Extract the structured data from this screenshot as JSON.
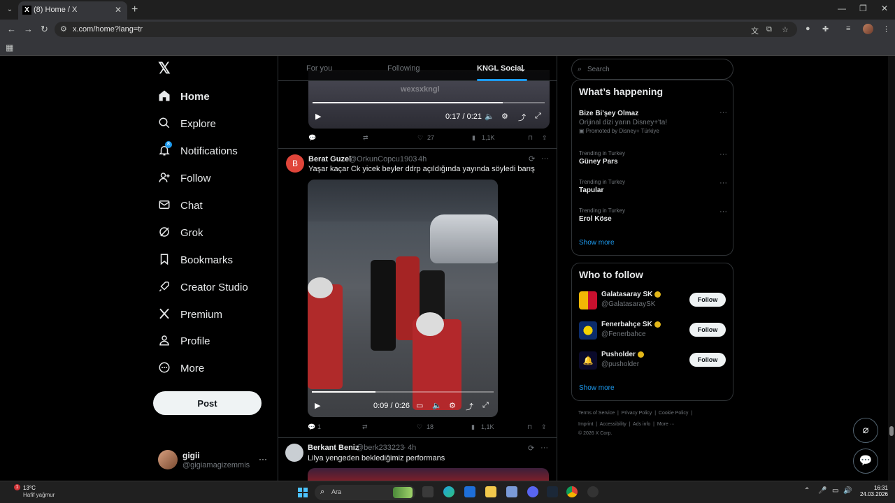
{
  "browser": {
    "tab_title": "(8) Home / X",
    "tab_favicon": "X",
    "url": "x.com/home?lang=tr"
  },
  "nav": {
    "items": [
      {
        "label": "Home",
        "icon": "home-icon"
      },
      {
        "label": "Explore",
        "icon": "search-icon"
      },
      {
        "label": "Notifications",
        "icon": "bell-icon",
        "badge": "8"
      },
      {
        "label": "Follow",
        "icon": "add-user-icon"
      },
      {
        "label": "Chat",
        "icon": "mail-icon"
      },
      {
        "label": "Grok",
        "icon": "grok-icon"
      },
      {
        "label": "Bookmarks",
        "icon": "bookmark-icon"
      },
      {
        "label": "Creator Studio",
        "icon": "rocket-icon"
      },
      {
        "label": "Premium",
        "icon": "x-icon"
      },
      {
        "label": "Profile",
        "icon": "person-icon"
      },
      {
        "label": "More",
        "icon": "more-circle-icon"
      }
    ],
    "post_label": "Post",
    "account": {
      "name": "gigii",
      "handle": "@gigiamagizemmis"
    }
  },
  "timeline": {
    "tabs": [
      "For you",
      "Following",
      "KNGL Social"
    ],
    "top_video": {
      "time": "0:17 / 0:21",
      "watermark": "wexsxkngl",
      "progress": 0.82
    },
    "top_actions": {
      "replies": "",
      "reposts": "",
      "likes": "27",
      "views": "1,1K"
    },
    "posts": [
      {
        "avatar_letter": "B",
        "name": "Berat Guzel",
        "handle": "@OrkunCopcu1903",
        "time": "4h",
        "text": "Yaşar kaçar Ck yicek beyler ddrp açıldığında yayında söyledi barış",
        "video_time": "0:09 / 0:26",
        "video_progress": 0.35,
        "replies": "1",
        "reposts": "",
        "likes": "18",
        "views": "1,1K"
      },
      {
        "name": "Berkant Beniz",
        "handle": "@berk233223",
        "time": "4h",
        "text": "Lilya yengeden beklediğimiz performans"
      }
    ]
  },
  "right": {
    "search_placeholder": "Search",
    "happening_title": "What’s happening",
    "trends": [
      {
        "context": "",
        "topic": "Bize Bi'şey Olmaz",
        "desc": "Orijinal dizi yarın Disney+'ta!",
        "promo": "Promoted by Disney+ Türkiye"
      },
      {
        "context": "Trending in Turkey",
        "topic": "Güney Pars"
      },
      {
        "context": "Trending in Turkey",
        "topic": "Tapular"
      },
      {
        "context": "Trending in Turkey",
        "topic": "Erol Köse"
      }
    ],
    "show_more": "Show more",
    "wtf_title": "Who to follow",
    "follow_label": "Follow",
    "accounts": [
      {
        "name": "Galatasaray SK",
        "handle": "@GalatasaraySK"
      },
      {
        "name": "Fenerbahçe SK",
        "handle": "@Fenerbahce"
      },
      {
        "name": "Pusholder",
        "handle": "@pusholder"
      }
    ],
    "footer": {
      "line1": [
        "Terms of Service",
        "Privacy Policy",
        "Cookie Policy"
      ],
      "line2": [
        "Imprint",
        "Accessibility",
        "Ads info",
        "More ···"
      ],
      "copyright": "© 2026 X Corp."
    }
  },
  "taskbar": {
    "temp": "13°C",
    "weather": "Hafif yağmur",
    "weather_badge": "1",
    "search_label": "Ara",
    "time": "16:31",
    "date": "24.03.2026"
  }
}
